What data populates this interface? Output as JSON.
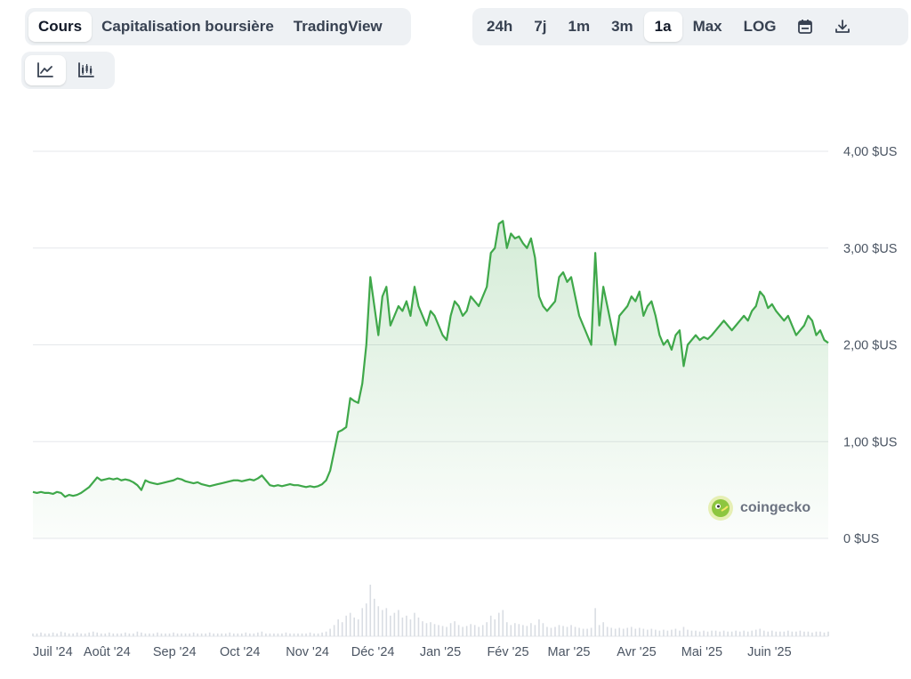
{
  "toolbar": {
    "view_tabs": [
      {
        "label": "Cours",
        "active": true
      },
      {
        "label": "Capitalisation boursière",
        "active": false
      },
      {
        "label": "TradingView",
        "active": false
      }
    ],
    "ranges": [
      {
        "label": "24h",
        "active": false
      },
      {
        "label": "7j",
        "active": false
      },
      {
        "label": "1m",
        "active": false
      },
      {
        "label": "3m",
        "active": false
      },
      {
        "label": "1a",
        "active": true
      },
      {
        "label": "Max",
        "active": false
      },
      {
        "label": "LOG",
        "active": false
      }
    ],
    "icons": [
      "calendar-icon",
      "download-icon"
    ],
    "chart_types": [
      "line-chart-icon",
      "candlestick-icon"
    ]
  },
  "watermark": {
    "brand": "coingecko"
  },
  "colors": {
    "line": "#3fa84a",
    "fill": "#3fa84a",
    "volume": "#d9dde3",
    "grid": "#e5e7eb"
  },
  "chart_data": {
    "type": "area",
    "x_tick_labels": [
      "Juil '24",
      "Août '24",
      "Sep '24",
      "Oct '24",
      "Nov '24",
      "Déc '24",
      "Jan '25",
      "Fév '25",
      "Mar '25",
      "Avr '25",
      "Mai '25",
      "Juin '25"
    ],
    "y_tick_labels": [
      "4,00 $US",
      "3,00 $US",
      "2,00 $US",
      "1,00 $US",
      "0 $US"
    ],
    "y_ticks": [
      4,
      3,
      2,
      1,
      0
    ],
    "ylim": [
      0,
      4
    ],
    "grid": true,
    "series": [
      {
        "x_start": "2024-06-28",
        "x_end": "2025-06-28",
        "values": [
          0.48,
          0.47,
          0.48,
          0.47,
          0.47,
          0.46,
          0.48,
          0.47,
          0.43,
          0.45,
          0.44,
          0.45,
          0.47,
          0.5,
          0.53,
          0.58,
          0.63,
          0.6,
          0.61,
          0.62,
          0.61,
          0.62,
          0.6,
          0.61,
          0.6,
          0.58,
          0.55,
          0.5,
          0.6,
          0.58,
          0.57,
          0.56,
          0.57,
          0.58,
          0.59,
          0.6,
          0.62,
          0.61,
          0.59,
          0.58,
          0.57,
          0.58,
          0.56,
          0.55,
          0.54,
          0.55,
          0.56,
          0.57,
          0.58,
          0.59,
          0.6,
          0.6,
          0.59,
          0.6,
          0.61,
          0.6,
          0.62,
          0.65,
          0.6,
          0.55,
          0.54,
          0.55,
          0.54,
          0.55,
          0.56,
          0.55,
          0.55,
          0.54,
          0.53,
          0.54,
          0.53,
          0.54,
          0.56,
          0.6,
          0.7,
          0.9,
          1.1,
          1.12,
          1.15,
          1.45,
          1.42,
          1.4,
          1.6,
          2.0,
          2.7,
          2.4,
          2.1,
          2.5,
          2.6,
          2.2,
          2.3,
          2.4,
          2.35,
          2.45,
          2.3,
          2.6,
          2.4,
          2.3,
          2.2,
          2.35,
          2.3,
          2.2,
          2.1,
          2.05,
          2.3,
          2.45,
          2.4,
          2.3,
          2.35,
          2.5,
          2.45,
          2.4,
          2.5,
          2.6,
          2.95,
          3.0,
          3.25,
          3.28,
          3.0,
          3.15,
          3.1,
          3.12,
          3.05,
          3.0,
          3.1,
          2.9,
          2.5,
          2.4,
          2.35,
          2.4,
          2.45,
          2.7,
          2.75,
          2.65,
          2.7,
          2.5,
          2.3,
          2.2,
          2.1,
          2.0,
          2.95,
          2.2,
          2.6,
          2.4,
          2.2,
          2.0,
          2.3,
          2.35,
          2.4,
          2.5,
          2.45,
          2.55,
          2.3,
          2.4,
          2.45,
          2.3,
          2.1,
          2.0,
          2.05,
          1.95,
          2.1,
          2.15,
          1.78,
          2.0,
          2.05,
          2.1,
          2.05,
          2.08,
          2.06,
          2.1,
          2.15,
          2.2,
          2.25,
          2.2,
          2.15,
          2.2,
          2.25,
          2.3,
          2.25,
          2.35,
          2.4,
          2.55,
          2.5,
          2.38,
          2.42,
          2.35,
          2.3,
          2.25,
          2.3,
          2.2,
          2.1,
          2.15,
          2.2,
          2.3,
          2.25,
          2.1,
          2.15,
          2.05,
          2.02
        ]
      }
    ],
    "volume": [
      0.03,
      0.03,
      0.04,
      0.03,
      0.03,
      0.04,
      0.03,
      0.05,
      0.04,
      0.03,
      0.03,
      0.04,
      0.03,
      0.03,
      0.04,
      0.05,
      0.04,
      0.03,
      0.03,
      0.04,
      0.03,
      0.03,
      0.03,
      0.04,
      0.03,
      0.03,
      0.05,
      0.04,
      0.03,
      0.03,
      0.03,
      0.04,
      0.03,
      0.03,
      0.03,
      0.04,
      0.03,
      0.03,
      0.03,
      0.03,
      0.04,
      0.03,
      0.03,
      0.03,
      0.04,
      0.03,
      0.03,
      0.03,
      0.03,
      0.04,
      0.03,
      0.03,
      0.03,
      0.04,
      0.03,
      0.03,
      0.04,
      0.05,
      0.03,
      0.03,
      0.03,
      0.03,
      0.03,
      0.04,
      0.03,
      0.03,
      0.03,
      0.03,
      0.03,
      0.04,
      0.03,
      0.03,
      0.04,
      0.05,
      0.08,
      0.12,
      0.18,
      0.15,
      0.22,
      0.25,
      0.2,
      0.18,
      0.3,
      0.35,
      0.55,
      0.4,
      0.32,
      0.28,
      0.3,
      0.22,
      0.25,
      0.28,
      0.2,
      0.22,
      0.18,
      0.25,
      0.2,
      0.16,
      0.14,
      0.15,
      0.13,
      0.12,
      0.11,
      0.1,
      0.14,
      0.16,
      0.12,
      0.1,
      0.11,
      0.13,
      0.12,
      0.1,
      0.12,
      0.15,
      0.22,
      0.18,
      0.25,
      0.28,
      0.15,
      0.12,
      0.14,
      0.13,
      0.12,
      0.11,
      0.14,
      0.12,
      0.18,
      0.14,
      0.1,
      0.09,
      0.1,
      0.12,
      0.11,
      0.1,
      0.12,
      0.1,
      0.09,
      0.08,
      0.08,
      0.09,
      0.3,
      0.12,
      0.15,
      0.1,
      0.09,
      0.08,
      0.09,
      0.08,
      0.09,
      0.1,
      0.08,
      0.09,
      0.08,
      0.07,
      0.08,
      0.07,
      0.06,
      0.07,
      0.06,
      0.07,
      0.08,
      0.06,
      0.1,
      0.07,
      0.06,
      0.06,
      0.05,
      0.06,
      0.05,
      0.06,
      0.06,
      0.05,
      0.06,
      0.05,
      0.05,
      0.06,
      0.05,
      0.06,
      0.05,
      0.06,
      0.07,
      0.08,
      0.06,
      0.05,
      0.06,
      0.05,
      0.05,
      0.05,
      0.06,
      0.05,
      0.05,
      0.06,
      0.05,
      0.05,
      0.04,
      0.05,
      0.05,
      0.04,
      0.05
    ]
  }
}
